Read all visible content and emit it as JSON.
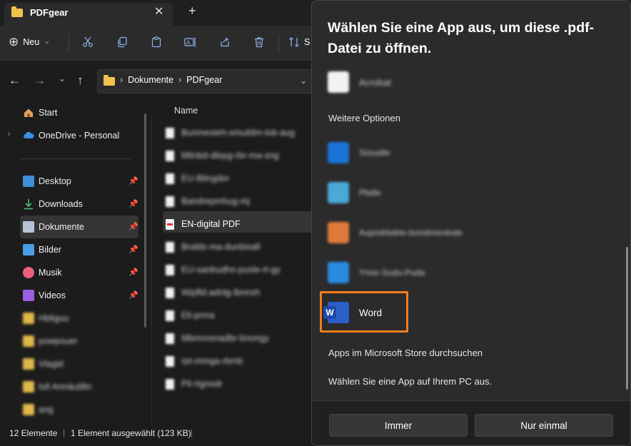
{
  "window": {
    "tab_title": "PDFgear",
    "close_glyph": "✕",
    "add_glyph": "+"
  },
  "toolbar": {
    "new_label": "Neu",
    "new_glyph": "⊕",
    "chevron_glyph": "⌄",
    "sort_label_partial": "S",
    "icons": [
      "cut-icon",
      "copy-icon",
      "paste-icon",
      "rename-icon",
      "share-icon",
      "delete-icon",
      "sort-icon"
    ]
  },
  "address": {
    "crumbs": [
      "Dokumente",
      "PDFgear"
    ],
    "separator": "›"
  },
  "nav": {
    "items": [
      {
        "label": "Start"
      },
      {
        "label": "OneDrive - Personal"
      },
      {
        "label": "Desktop"
      },
      {
        "label": "Downloads"
      },
      {
        "label": "Dokumente"
      },
      {
        "label": "Bilder"
      },
      {
        "label": "Musik"
      },
      {
        "label": "Videos"
      }
    ],
    "blurred_items": [
      "Hbliguu",
      "powpouer",
      "Vlagid",
      "ls8 Annäutiltn",
      "ang"
    ]
  },
  "files": {
    "column_name": "Name",
    "rows": [
      {
        "name": "Bunmesieh-smuildm-lob-aug",
        "blurred": true
      },
      {
        "name": "Mlinbd-dlepg-rbr-ma-sng",
        "blurred": true
      },
      {
        "name": "EU-Blingdor",
        "blurred": true
      },
      {
        "name": "Bandrepmhug-mj",
        "blurred": true
      },
      {
        "name": "EN-digital PDF",
        "blurred": false
      },
      {
        "name": "Bralds-ma-dunbisall",
        "blurred": true
      },
      {
        "name": "EU-sanbudhs-pusle-rt-gy",
        "blurred": true
      },
      {
        "name": "Wipfld-adnlg-lbnnsh",
        "blurred": true
      },
      {
        "name": "Eli-prma",
        "blurred": true
      },
      {
        "name": "Mbmnrenadbr-bnongy",
        "blurred": true
      },
      {
        "name": "rpt-mmga-rbmb",
        "blurred": true
      },
      {
        "name": "Pil-rtgnodr",
        "blurred": true
      }
    ]
  },
  "status": {
    "count": "12 Elemente",
    "selection": "1 Element ausgewählt (123 KB)"
  },
  "dialog": {
    "title": "Wählen Sie eine App aus, um diese .pdf-Datei zu öffnen.",
    "top_app_blurred": "Acrobat",
    "section_label": "Weitere Optionen",
    "apps": [
      {
        "label": "Sioualbr",
        "blurred": true,
        "color": "#1a73d9"
      },
      {
        "label": "Pbdle",
        "blurred": true,
        "color": "#4aa9d6"
      },
      {
        "label": "Aupndrbdrle-lsondmsrdnde",
        "blurred": true,
        "color": "#e07a3a"
      },
      {
        "label": "Ymsr-Sudu-Puda",
        "blurred": true,
        "color": "#2a8ae0"
      },
      {
        "label": "Word",
        "blurred": false,
        "color": "#2b5fc9"
      }
    ],
    "store_link": "Apps im Microsoft Store durchsuchen",
    "pc_link": "Wählen Sie eine App auf Ihrem PC aus.",
    "btn_always": "Immer",
    "btn_once": "Nur einmal",
    "highlight_color": "#f07d1f"
  }
}
